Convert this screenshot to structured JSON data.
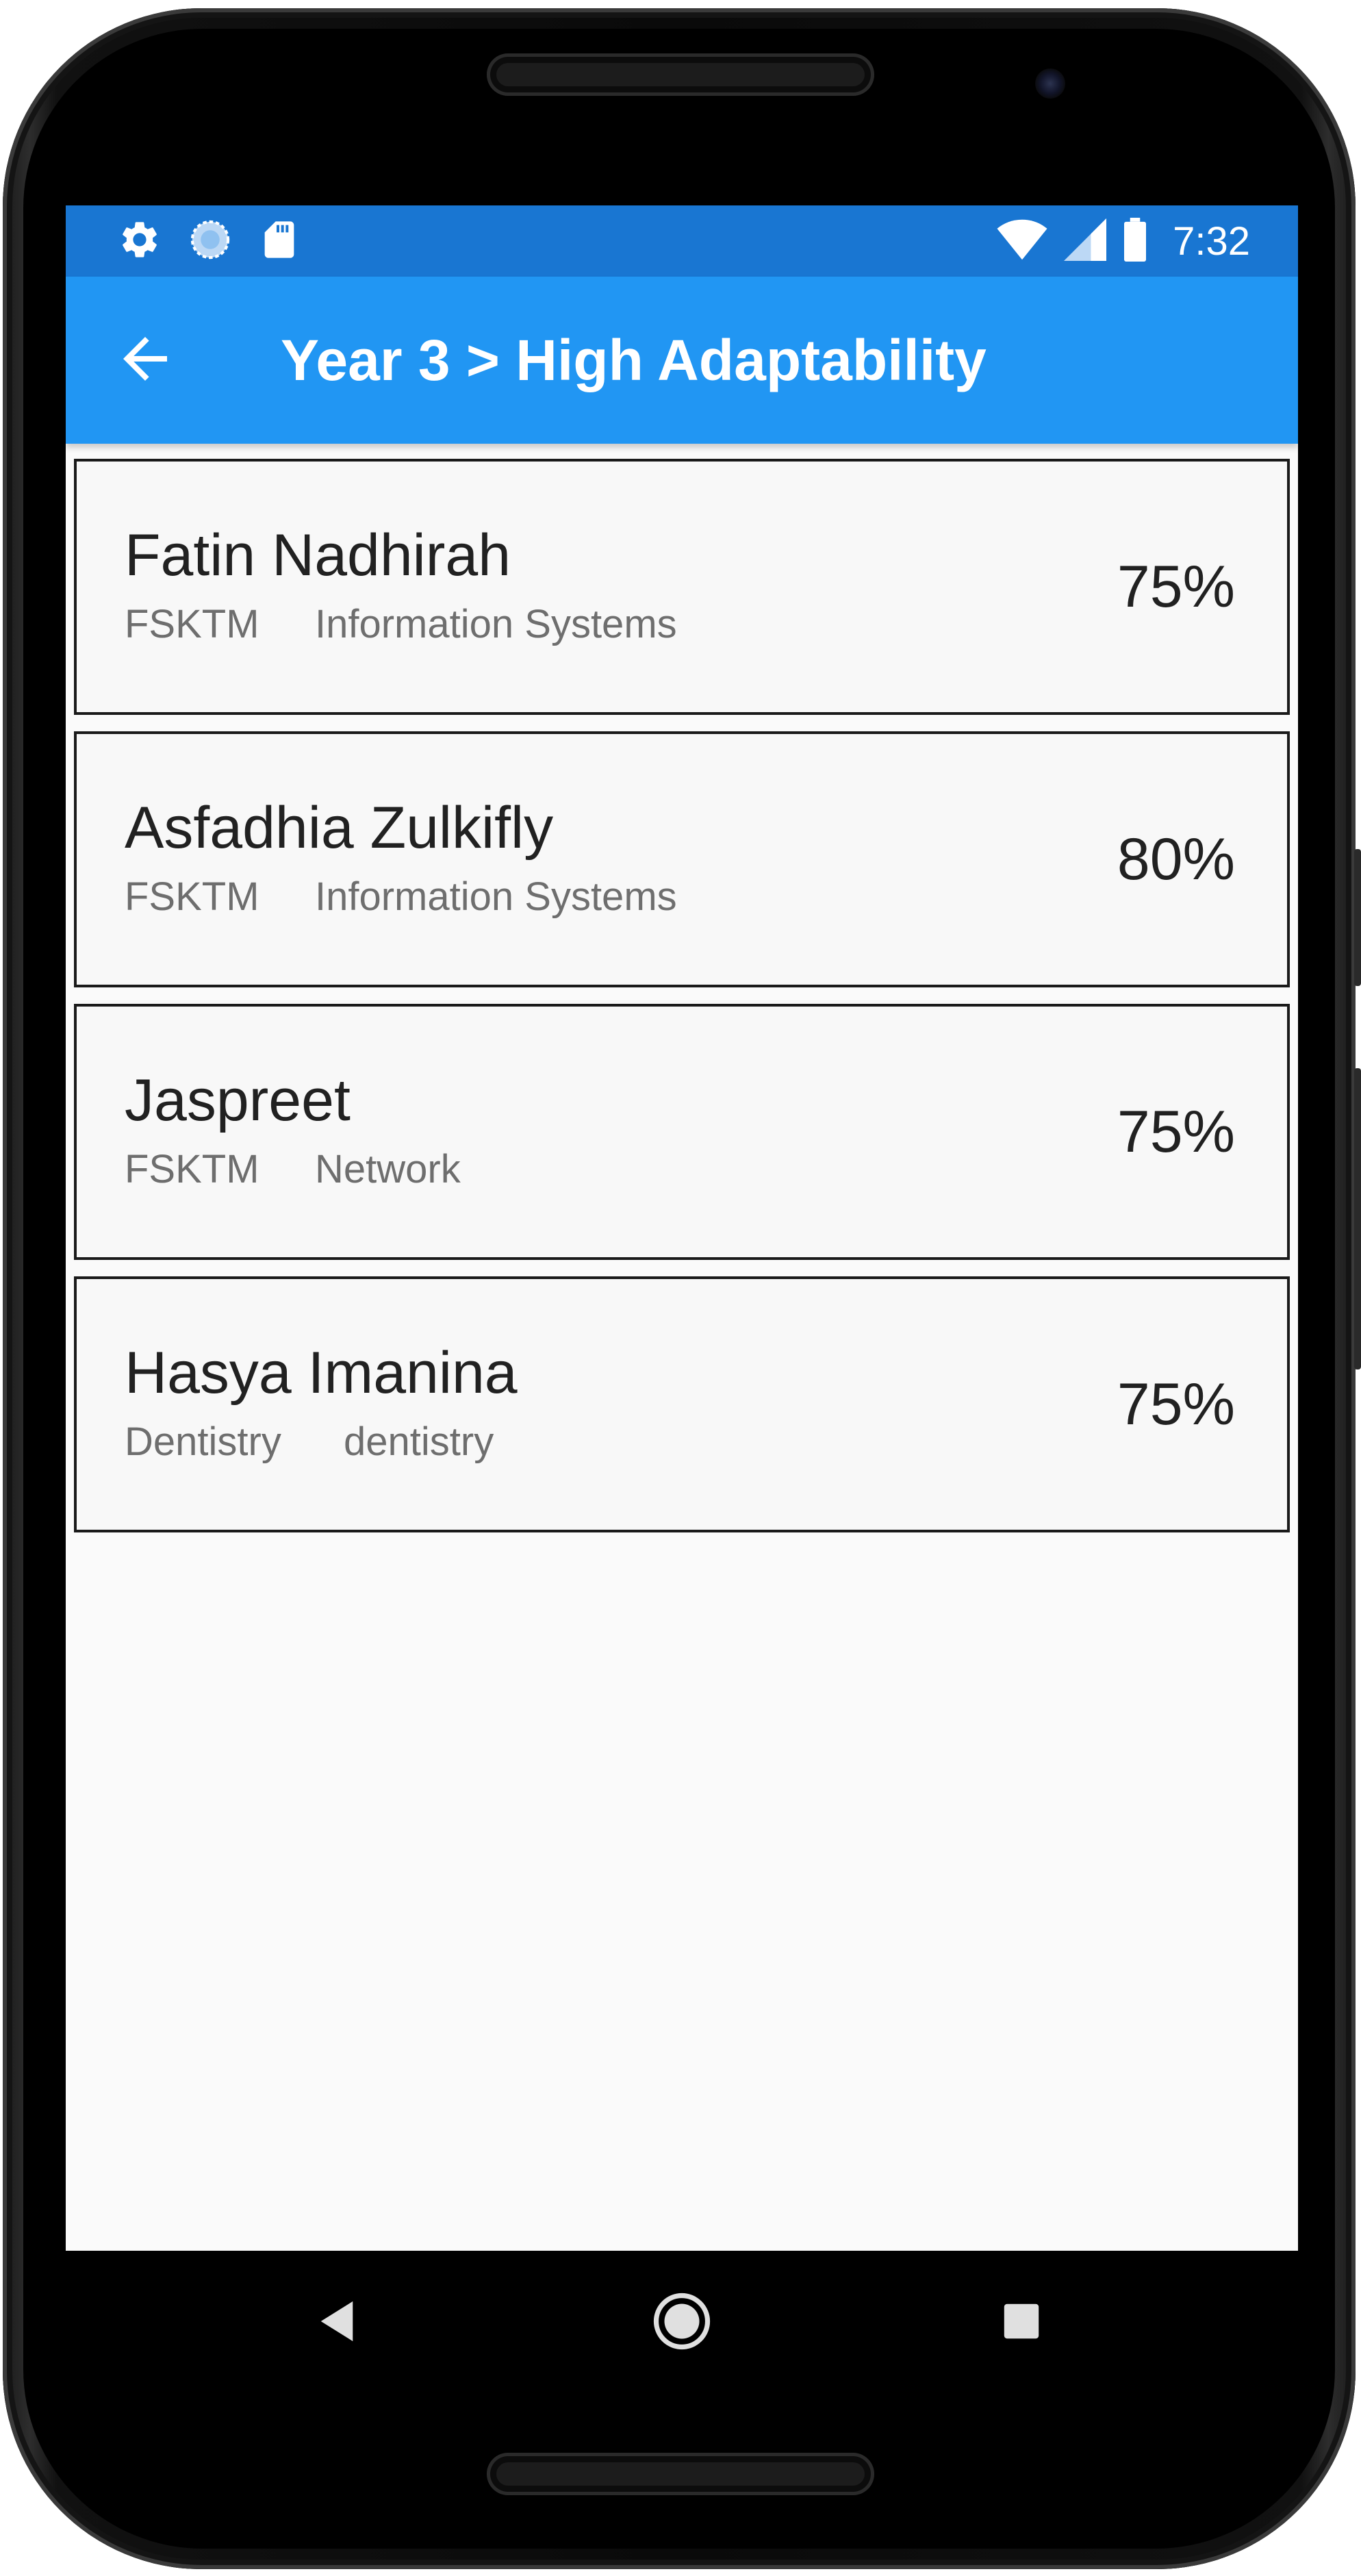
{
  "status_bar": {
    "time": "7:32",
    "left_icons": [
      "settings-icon",
      "sync-icon",
      "sd-card-icon"
    ],
    "right_icons": [
      "wifi-icon",
      "signal-icon",
      "battery-icon"
    ]
  },
  "app_bar": {
    "title": "Year 3 > High Adaptability",
    "back_icon": "arrow-left-icon"
  },
  "students": [
    {
      "name": "Fatin Nadhirah",
      "faculty": "FSKTM",
      "program": "Information Systems",
      "score": "75%"
    },
    {
      "name": "Asfadhia Zulkifly",
      "faculty": "FSKTM",
      "program": "Information Systems",
      "score": "80%"
    },
    {
      "name": "Jaspreet",
      "faculty": "FSKTM",
      "program": "Network",
      "score": "75%"
    },
    {
      "name": "Hasya Imanina",
      "faculty": "Dentistry",
      "program": "dentistry",
      "score": "75%"
    }
  ],
  "nav_bar": {
    "icons": [
      "back-triangle-icon",
      "home-circle-icon",
      "recents-square-icon"
    ]
  },
  "colors": {
    "status_bar": "#1976d2",
    "app_bar": "#2196f3",
    "background": "#fafafa",
    "card_border": "#1a1a1a",
    "primary_text": "#212121",
    "secondary_text": "#6e6e6e"
  }
}
